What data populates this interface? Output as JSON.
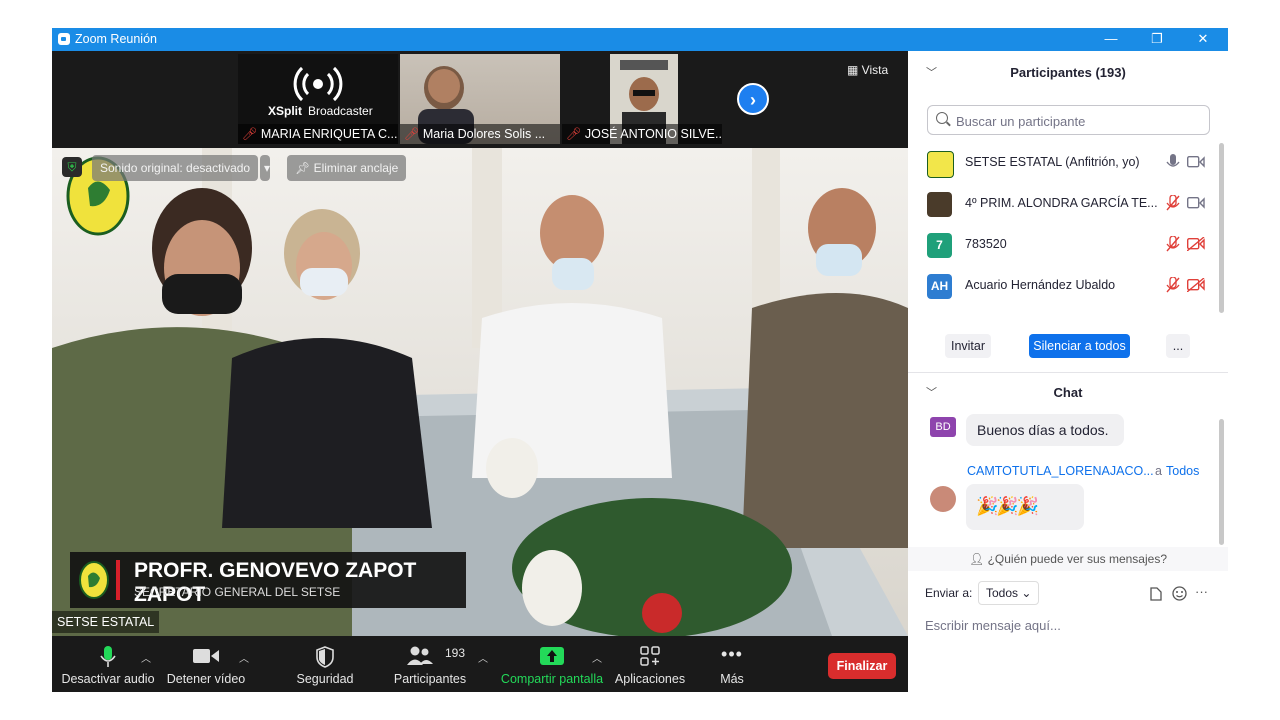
{
  "window": {
    "title": "Zoom Reunión",
    "minimize": "—",
    "restore": "❐",
    "close": "✕"
  },
  "video": {
    "vista_label": "Vista",
    "thumbnails": [
      {
        "name": "MARIA ENRIQUETA C...",
        "logo_text_1": "XSplit",
        "logo_text_2": "Broadcaster"
      },
      {
        "name": "Maria Dolores Solis ..."
      },
      {
        "name": "JOSÉ ANTONIO SILVE..."
      }
    ],
    "original_sound": "Sonido original: desactivado",
    "unpin": "Eliminar anclaje",
    "speaker_name": "PROFR. GENOVEVO ZAPOT ZAPOT",
    "speaker_role": "SECRETARIO GENERAL DEL SETSE",
    "speaker_tag": "SETSE ESTATAL"
  },
  "toolbar": {
    "mute_audio": "Desactivar audio",
    "stop_video": "Detener vídeo",
    "security": "Seguridad",
    "participants": "Participantes",
    "participants_count": "193",
    "share_screen": "Compartir pantalla",
    "apps": "Aplicaciones",
    "more": "Más",
    "end": "Finalizar"
  },
  "participants_panel": {
    "header": "Participantes (193)",
    "search_placeholder": "Buscar un participante",
    "list": [
      {
        "name": "SETSE ESTATAL (Anfitrión, yo)",
        "avatar": "",
        "avatar_color": "#f2e64a",
        "mic_muted": false,
        "cam_off": false
      },
      {
        "name": "4º PRIM. ALONDRA GARCÍA TE...",
        "avatar": "",
        "avatar_color": "#4a3b2a",
        "mic_muted": true,
        "cam_off": false
      },
      {
        "name": "783520",
        "avatar": "7",
        "avatar_color": "#1fa07a",
        "mic_muted": true,
        "cam_off": true
      },
      {
        "name": "Acuario Hernández Ubaldo",
        "avatar": "AH",
        "avatar_color": "#2e7dd1",
        "mic_muted": true,
        "cam_off": true
      }
    ],
    "invite": "Invitar",
    "mute_all": "Silenciar a todos",
    "more": "..."
  },
  "chat": {
    "header": "Chat",
    "messages": [
      {
        "avatar": "BD",
        "avatar_color": "#8e44ad",
        "text": "Buenos días a todos."
      },
      {
        "sender": "CAMTOTUTLA_LORENAJACO...",
        "to_prefix": "a",
        "to": "Todos",
        "text": "🎉🎉🎉"
      }
    ],
    "who_can_see": "¿Quién puede ver sus mensajes?",
    "send_to_label": "Enviar a:",
    "send_to_value": "Todos",
    "input_placeholder": "Escribir mensaje aquí...",
    "more": "···"
  },
  "colors": {
    "accent": "#0e71eb",
    "titlebar": "#1a8ce6",
    "end_button": "#d92d2d",
    "share_green": "#23d959",
    "muted_red": "#e0403a"
  }
}
